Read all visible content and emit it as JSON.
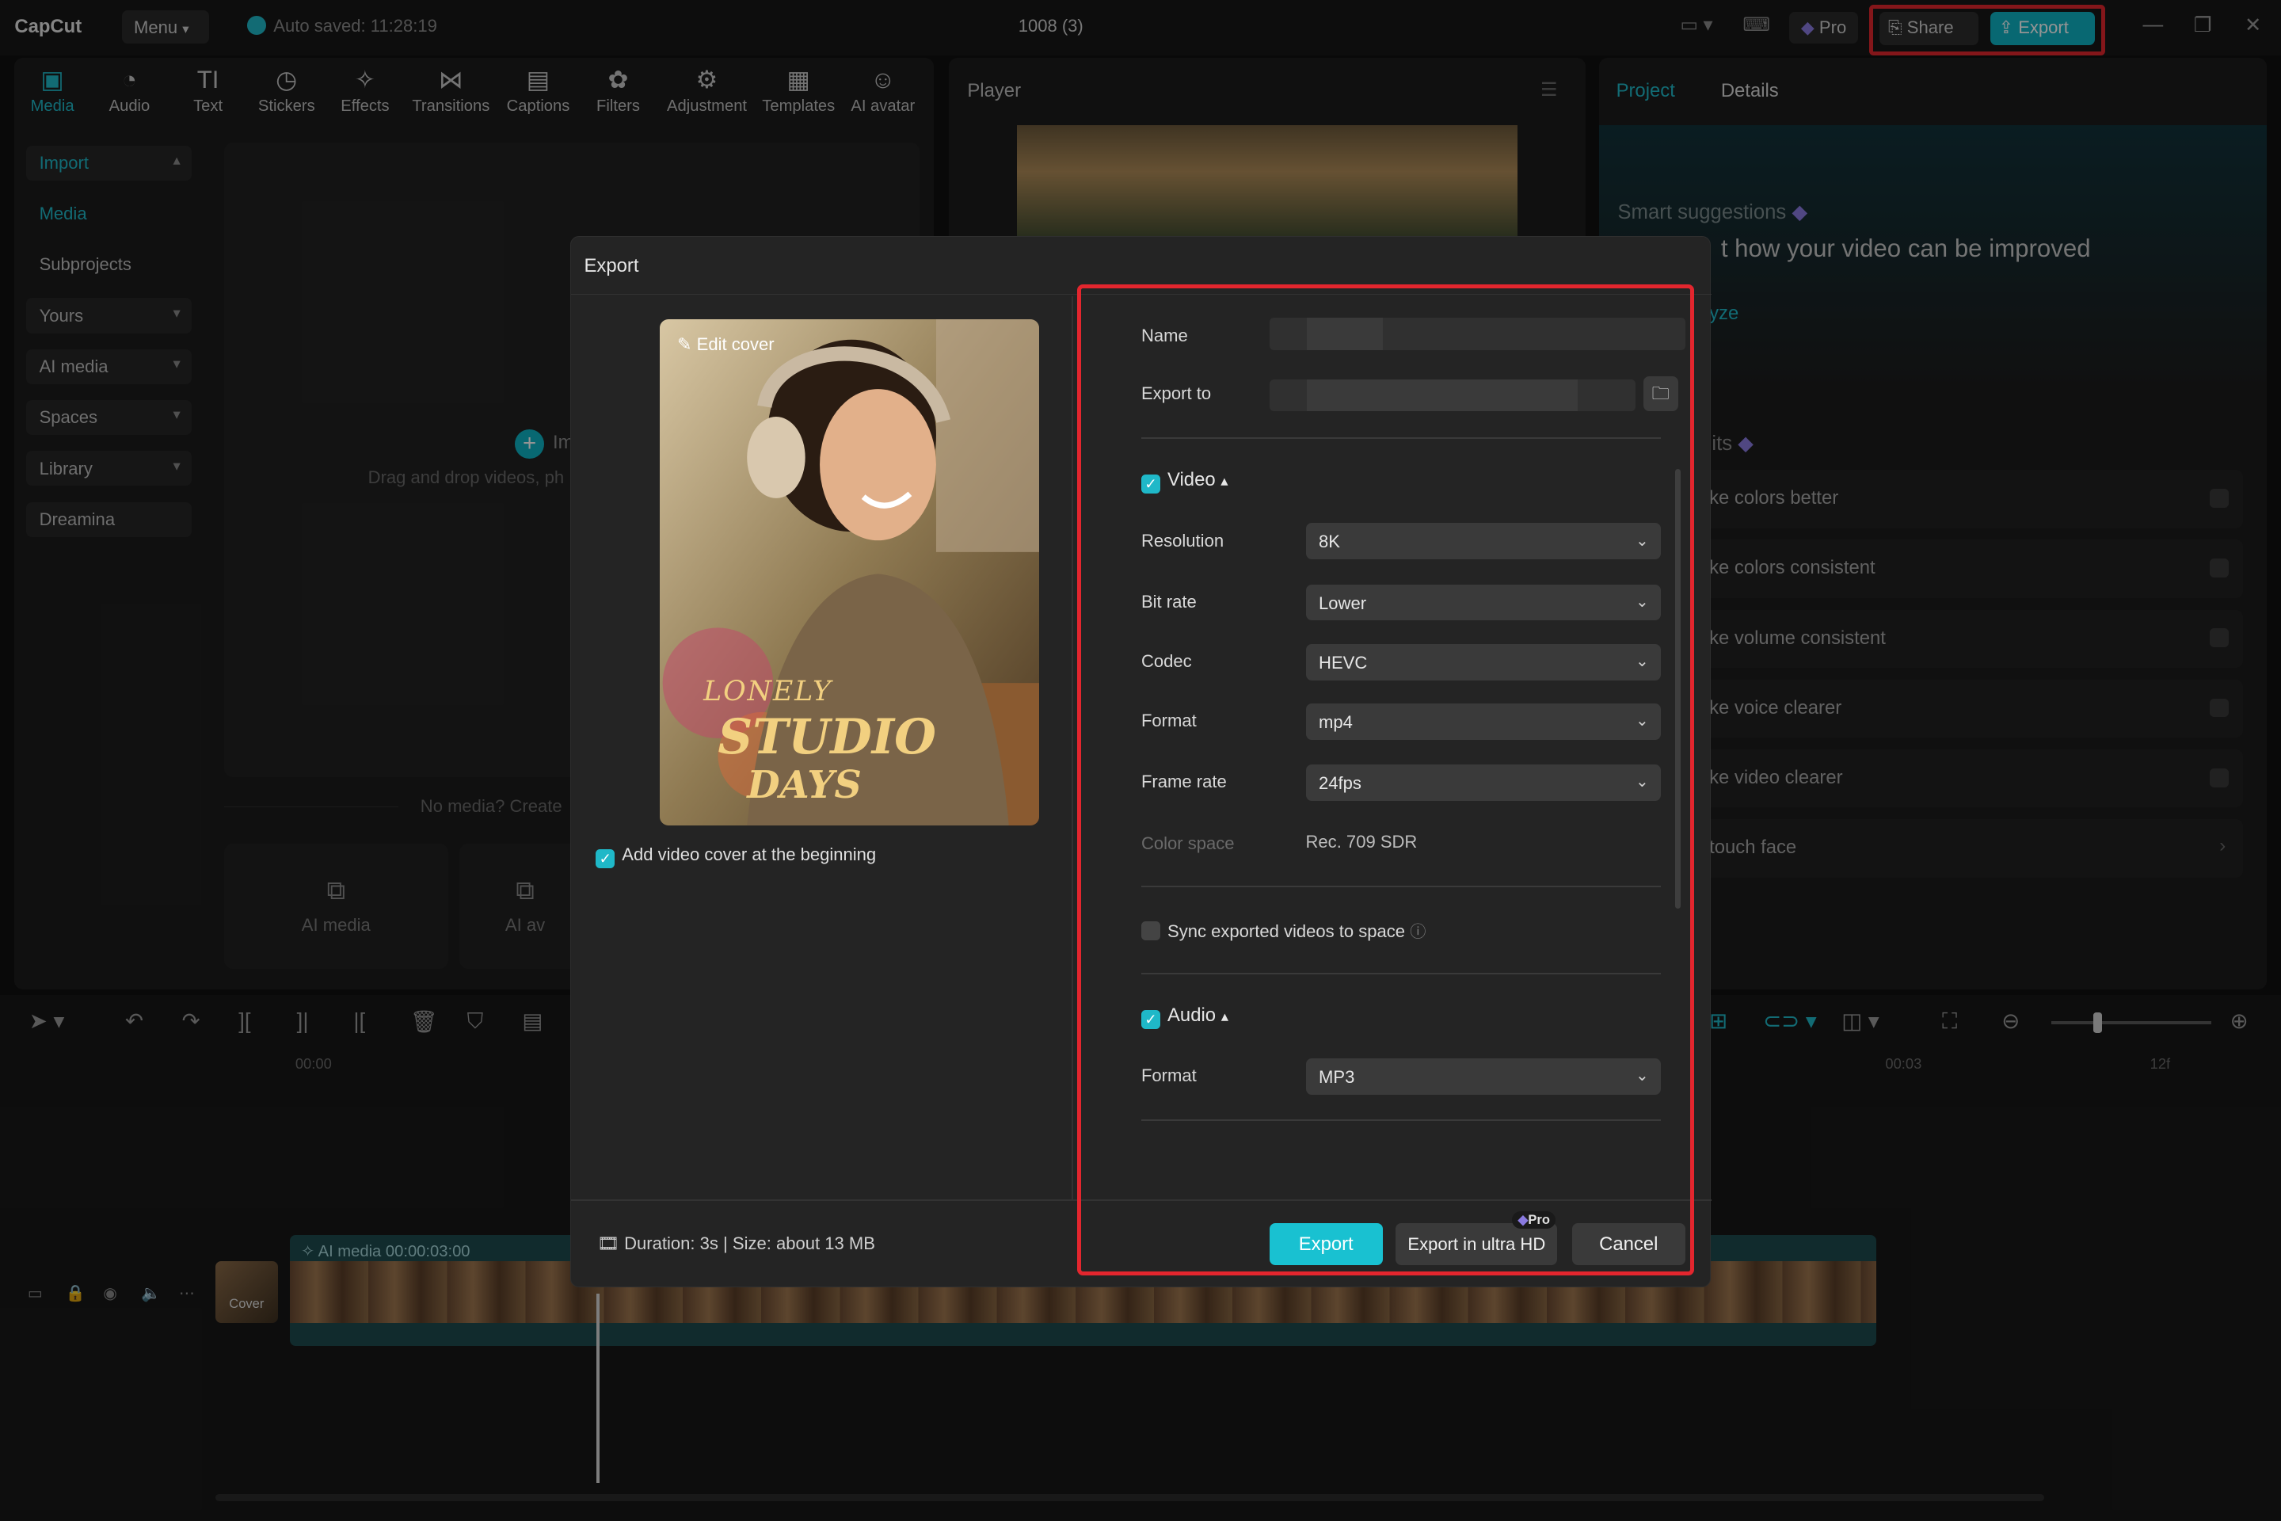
{
  "app": {
    "logo": "CapCut",
    "menu_label": "Menu",
    "autosave": "Auto saved: 11:28:19",
    "project_title": "1008 (3)",
    "pro_label": "Pro",
    "share_label": "Share",
    "export_label": "Export"
  },
  "tool_tabs": [
    {
      "label": "Media",
      "icon": "media-icon"
    },
    {
      "label": "Audio",
      "icon": "audio-icon"
    },
    {
      "label": "Text",
      "icon": "text-icon"
    },
    {
      "label": "Stickers",
      "icon": "stickers-icon"
    },
    {
      "label": "Effects",
      "icon": "effects-icon"
    },
    {
      "label": "Transitions",
      "icon": "transitions-icon"
    },
    {
      "label": "Captions",
      "icon": "captions-icon"
    },
    {
      "label": "Filters",
      "icon": "filters-icon"
    },
    {
      "label": "Adjustment",
      "icon": "adjustment-icon"
    },
    {
      "label": "Templates",
      "icon": "templates-icon"
    },
    {
      "label": "AI avatar",
      "icon": "ai-avatar-icon"
    }
  ],
  "left_nav": [
    {
      "label": "Import"
    },
    {
      "label": "Media"
    },
    {
      "label": "Subprojects"
    },
    {
      "label": "Yours"
    },
    {
      "label": "AI media"
    },
    {
      "label": "Spaces"
    },
    {
      "label": "Library"
    },
    {
      "label": "Dreamina"
    }
  ],
  "media": {
    "import_label": "Im",
    "drop_hint": "Drag and drop videos, ph",
    "no_media": "No media? Create",
    "card_ai_media": "AI media",
    "card_ai_avatar": "AI av"
  },
  "player": {
    "title": "Player"
  },
  "right_panel": {
    "tab_project": "Project",
    "tab_details": "Details",
    "smart_title": "Smart suggestions",
    "smart_headline": "t how your video can be improved",
    "analyze_label": "yze",
    "edits_title": "dits",
    "suggestions": [
      "ke colors better",
      "ke colors consistent",
      "ke volume consistent",
      "ke voice clearer",
      "ke video clearer",
      "touch face"
    ]
  },
  "timeline": {
    "time_start": "00:00",
    "time_mid": "00:03",
    "time_end": "12f",
    "clip_label": "AI media",
    "clip_duration": "00:00:03:00",
    "cover_label": "Cover"
  },
  "export_dialog": {
    "title": "Export",
    "edit_cover": "Edit cover",
    "cover_text": {
      "line1": "LONELY",
      "line2": "STUDIO",
      "line3": "DAYS"
    },
    "add_cover_label": "Add video cover at the beginning",
    "add_cover_checked": true,
    "name_label": "Name",
    "export_to_label": "Export to",
    "video_section": "Video",
    "video_checked": true,
    "resolution_label": "Resolution",
    "resolution_value": "8K",
    "bitrate_label": "Bit rate",
    "bitrate_value": "Lower",
    "codec_label": "Codec",
    "codec_value": "HEVC",
    "format_label": "Format",
    "format_value": "mp4",
    "framerate_label": "Frame rate",
    "framerate_value": "24fps",
    "colorspace_label": "Color space",
    "colorspace_value": "Rec. 709 SDR",
    "sync_label": "Sync exported videos to space",
    "sync_checked": false,
    "audio_section": "Audio",
    "audio_checked": true,
    "audio_format_label": "Format",
    "audio_format_value": "MP3",
    "duration_size": "Duration: 3s | Size: about 13 MB",
    "export_button": "Export",
    "ultra_button": "Export in ultra HD",
    "pro_badge": "Pro",
    "cancel_button": "Cancel"
  },
  "colors": {
    "accent": "#19c1d1",
    "highlight_red": "#e3262e",
    "panel": "#1d1d1d",
    "dialog": "#242424"
  }
}
